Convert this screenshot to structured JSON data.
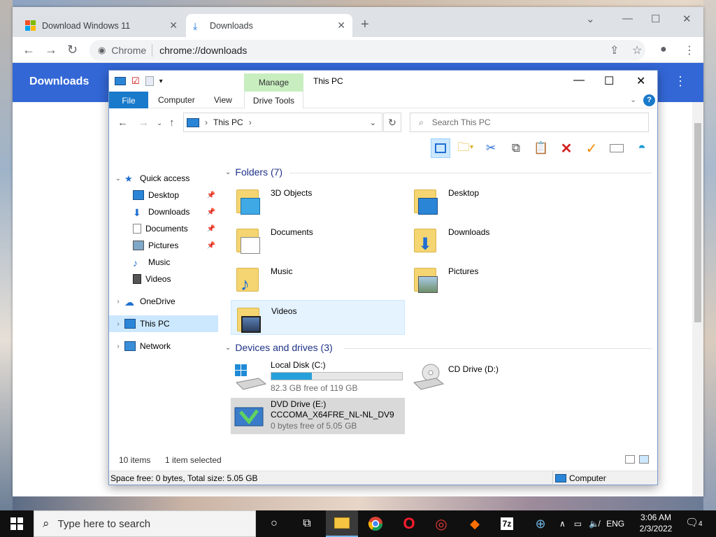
{
  "browser": {
    "tabs": [
      {
        "title": "Download Windows 11",
        "active": false
      },
      {
        "title": "Downloads",
        "active": true
      }
    ],
    "omnibox_site": "Chrome",
    "omnibox_url": "chrome://downloads",
    "page_title": "Downloads"
  },
  "explorer": {
    "title": "This PC",
    "manage_tab": "Manage",
    "ribbon_tabs": [
      "File",
      "Computer",
      "View",
      "Drive Tools"
    ],
    "address": "This PC",
    "search_placeholder": "Search This PC",
    "nav": {
      "quick_access": "Quick access",
      "quick_items": [
        "Desktop",
        "Downloads",
        "Documents",
        "Pictures",
        "Music",
        "Videos"
      ],
      "onedrive": "OneDrive",
      "this_pc": "This PC",
      "network": "Network"
    },
    "folders_header": "Folders (7)",
    "folders": [
      "3D Objects",
      "Desktop",
      "Documents",
      "Downloads",
      "Music",
      "Pictures",
      "Videos"
    ],
    "drives_header": "Devices and drives (3)",
    "drives": {
      "c": {
        "name": "Local Disk (C:)",
        "free": "82.3 GB free of 119 GB",
        "used_fraction": 0.31
      },
      "d": {
        "name": "CD Drive (D:)"
      },
      "e": {
        "name": "DVD Drive (E:)",
        "label": "CCCOMA_X64FRE_NL-NL_DV9",
        "free": "0 bytes free of 5.05 GB"
      }
    },
    "status_items": "10 items",
    "status_selected": "1 item selected",
    "bottom_left": "Space free: 0 bytes, Total size: 5.05 GB",
    "bottom_right": "Computer"
  },
  "taskbar": {
    "search_placeholder": "Type here to search",
    "lang": "ENG",
    "time": "3:06 AM",
    "date": "2/3/2022",
    "notif_count": "4"
  }
}
